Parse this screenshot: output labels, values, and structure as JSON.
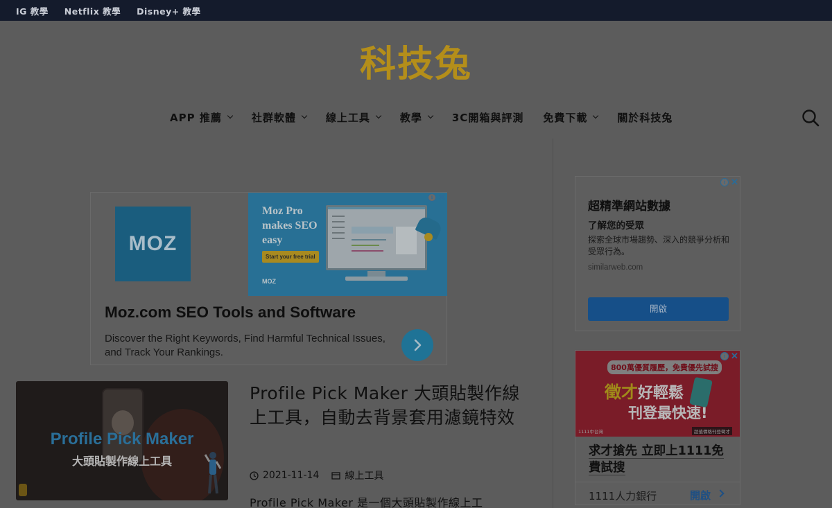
{
  "topbar": {
    "links": [
      "IG 教學",
      "Netflix 教學",
      "Disney+ 教學"
    ]
  },
  "site": {
    "logo": "科技兔"
  },
  "nav": {
    "items": [
      {
        "label": "APP 推薦",
        "dropdown": true
      },
      {
        "label": "社群軟體",
        "dropdown": true
      },
      {
        "label": "線上工具",
        "dropdown": true
      },
      {
        "label": "教學",
        "dropdown": true
      },
      {
        "label": "3C開箱與評測",
        "dropdown": false
      },
      {
        "label": "免費下載",
        "dropdown": true
      },
      {
        "label": "關於科技兔",
        "dropdown": false
      }
    ],
    "search_icon": "search-icon"
  },
  "main_ad": {
    "logo_text": "MOZ",
    "banner_text": "Moz Pro makes SEO easy",
    "banner_cta": "Start your free trial",
    "banner_logo": "MOZ",
    "title": "Moz.com SEO Tools and Software",
    "description": "Discover the Right Keywords, Find Harmful Technical Issues, and Track Your Rankings.",
    "adchoice_icon": "i",
    "close_icon": "✕"
  },
  "article": {
    "thumb_title": "Profile Pick Maker",
    "thumb_subtitle": "大頭貼製作線上工具",
    "title": "Profile Pick Maker 大頭貼製作線上工具，自動去背景套用濾鏡特效",
    "date": "2021-11-14",
    "category": "線上工具",
    "excerpt": "Profile Pick Maker 是一個大頭貼製作線上工"
  },
  "side_ad1": {
    "headline": "超精準網站數據",
    "subheadline": "了解您的受眾",
    "description": "探索全球市場趨勢、深入的競爭分析和受眾行為。",
    "url": "similarweb.com",
    "button": "開啟",
    "adchoice_icon": "i",
    "close_icon": "✕"
  },
  "side_ad2": {
    "banner_pill": "800萬優質履歷，免費優先試搜",
    "banner_line1_a": "徵才",
    "banner_line1_b": "好輕鬆",
    "banner_line2": "刊登最快速!",
    "banner_brand": "1111中台灣",
    "banner_price": "超值價格刊登徵才",
    "title": "求才搶先 立即上1111免費試搜",
    "source": "1111人力銀行",
    "button": "開啟",
    "adchoice_icon": "i",
    "close_icon": "✕"
  },
  "colors": {
    "topbar": "#141b2c",
    "logo": "#b48e1a",
    "overlay_bg": "#5c5c5c",
    "ad_button": "#164f88",
    "link_blue": "#1d4f85"
  }
}
